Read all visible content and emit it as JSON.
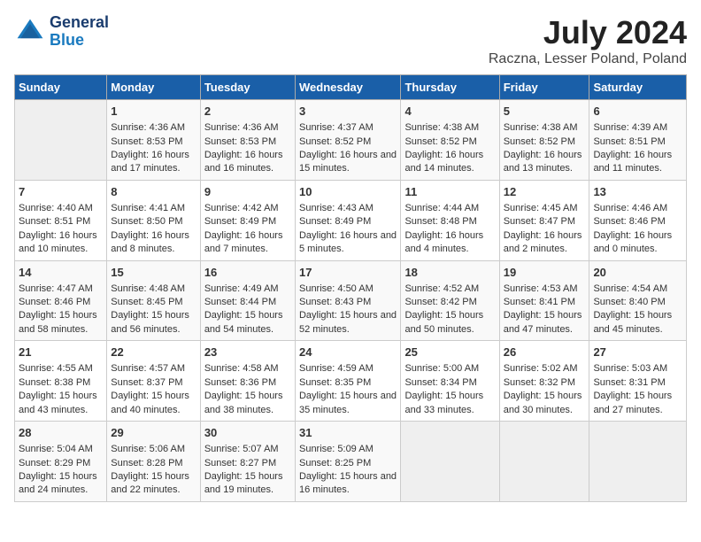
{
  "header": {
    "logo_line1": "General",
    "logo_line2": "Blue",
    "title": "July 2024",
    "subtitle": "Raczna, Lesser Poland, Poland"
  },
  "calendar": {
    "days_of_week": [
      "Sunday",
      "Monday",
      "Tuesday",
      "Wednesday",
      "Thursday",
      "Friday",
      "Saturday"
    ],
    "weeks": [
      [
        {
          "day": "",
          "sunrise": "",
          "sunset": "",
          "daylight": "",
          "empty": true
        },
        {
          "day": "1",
          "sunrise": "Sunrise: 4:36 AM",
          "sunset": "Sunset: 8:53 PM",
          "daylight": "Daylight: 16 hours and 17 minutes."
        },
        {
          "day": "2",
          "sunrise": "Sunrise: 4:36 AM",
          "sunset": "Sunset: 8:53 PM",
          "daylight": "Daylight: 16 hours and 16 minutes."
        },
        {
          "day": "3",
          "sunrise": "Sunrise: 4:37 AM",
          "sunset": "Sunset: 8:52 PM",
          "daylight": "Daylight: 16 hours and 15 minutes."
        },
        {
          "day": "4",
          "sunrise": "Sunrise: 4:38 AM",
          "sunset": "Sunset: 8:52 PM",
          "daylight": "Daylight: 16 hours and 14 minutes."
        },
        {
          "day": "5",
          "sunrise": "Sunrise: 4:38 AM",
          "sunset": "Sunset: 8:52 PM",
          "daylight": "Daylight: 16 hours and 13 minutes."
        },
        {
          "day": "6",
          "sunrise": "Sunrise: 4:39 AM",
          "sunset": "Sunset: 8:51 PM",
          "daylight": "Daylight: 16 hours and 11 minutes."
        }
      ],
      [
        {
          "day": "7",
          "sunrise": "Sunrise: 4:40 AM",
          "sunset": "Sunset: 8:51 PM",
          "daylight": "Daylight: 16 hours and 10 minutes."
        },
        {
          "day": "8",
          "sunrise": "Sunrise: 4:41 AM",
          "sunset": "Sunset: 8:50 PM",
          "daylight": "Daylight: 16 hours and 8 minutes."
        },
        {
          "day": "9",
          "sunrise": "Sunrise: 4:42 AM",
          "sunset": "Sunset: 8:49 PM",
          "daylight": "Daylight: 16 hours and 7 minutes."
        },
        {
          "day": "10",
          "sunrise": "Sunrise: 4:43 AM",
          "sunset": "Sunset: 8:49 PM",
          "daylight": "Daylight: 16 hours and 5 minutes."
        },
        {
          "day": "11",
          "sunrise": "Sunrise: 4:44 AM",
          "sunset": "Sunset: 8:48 PM",
          "daylight": "Daylight: 16 hours and 4 minutes."
        },
        {
          "day": "12",
          "sunrise": "Sunrise: 4:45 AM",
          "sunset": "Sunset: 8:47 PM",
          "daylight": "Daylight: 16 hours and 2 minutes."
        },
        {
          "day": "13",
          "sunrise": "Sunrise: 4:46 AM",
          "sunset": "Sunset: 8:46 PM",
          "daylight": "Daylight: 16 hours and 0 minutes."
        }
      ],
      [
        {
          "day": "14",
          "sunrise": "Sunrise: 4:47 AM",
          "sunset": "Sunset: 8:46 PM",
          "daylight": "Daylight: 15 hours and 58 minutes."
        },
        {
          "day": "15",
          "sunrise": "Sunrise: 4:48 AM",
          "sunset": "Sunset: 8:45 PM",
          "daylight": "Daylight: 15 hours and 56 minutes."
        },
        {
          "day": "16",
          "sunrise": "Sunrise: 4:49 AM",
          "sunset": "Sunset: 8:44 PM",
          "daylight": "Daylight: 15 hours and 54 minutes."
        },
        {
          "day": "17",
          "sunrise": "Sunrise: 4:50 AM",
          "sunset": "Sunset: 8:43 PM",
          "daylight": "Daylight: 15 hours and 52 minutes."
        },
        {
          "day": "18",
          "sunrise": "Sunrise: 4:52 AM",
          "sunset": "Sunset: 8:42 PM",
          "daylight": "Daylight: 15 hours and 50 minutes."
        },
        {
          "day": "19",
          "sunrise": "Sunrise: 4:53 AM",
          "sunset": "Sunset: 8:41 PM",
          "daylight": "Daylight: 15 hours and 47 minutes."
        },
        {
          "day": "20",
          "sunrise": "Sunrise: 4:54 AM",
          "sunset": "Sunset: 8:40 PM",
          "daylight": "Daylight: 15 hours and 45 minutes."
        }
      ],
      [
        {
          "day": "21",
          "sunrise": "Sunrise: 4:55 AM",
          "sunset": "Sunset: 8:38 PM",
          "daylight": "Daylight: 15 hours and 43 minutes."
        },
        {
          "day": "22",
          "sunrise": "Sunrise: 4:57 AM",
          "sunset": "Sunset: 8:37 PM",
          "daylight": "Daylight: 15 hours and 40 minutes."
        },
        {
          "day": "23",
          "sunrise": "Sunrise: 4:58 AM",
          "sunset": "Sunset: 8:36 PM",
          "daylight": "Daylight: 15 hours and 38 minutes."
        },
        {
          "day": "24",
          "sunrise": "Sunrise: 4:59 AM",
          "sunset": "Sunset: 8:35 PM",
          "daylight": "Daylight: 15 hours and 35 minutes."
        },
        {
          "day": "25",
          "sunrise": "Sunrise: 5:00 AM",
          "sunset": "Sunset: 8:34 PM",
          "daylight": "Daylight: 15 hours and 33 minutes."
        },
        {
          "day": "26",
          "sunrise": "Sunrise: 5:02 AM",
          "sunset": "Sunset: 8:32 PM",
          "daylight": "Daylight: 15 hours and 30 minutes."
        },
        {
          "day": "27",
          "sunrise": "Sunrise: 5:03 AM",
          "sunset": "Sunset: 8:31 PM",
          "daylight": "Daylight: 15 hours and 27 minutes."
        }
      ],
      [
        {
          "day": "28",
          "sunrise": "Sunrise: 5:04 AM",
          "sunset": "Sunset: 8:29 PM",
          "daylight": "Daylight: 15 hours and 24 minutes."
        },
        {
          "day": "29",
          "sunrise": "Sunrise: 5:06 AM",
          "sunset": "Sunset: 8:28 PM",
          "daylight": "Daylight: 15 hours and 22 minutes."
        },
        {
          "day": "30",
          "sunrise": "Sunrise: 5:07 AM",
          "sunset": "Sunset: 8:27 PM",
          "daylight": "Daylight: 15 hours and 19 minutes."
        },
        {
          "day": "31",
          "sunrise": "Sunrise: 5:09 AM",
          "sunset": "Sunset: 8:25 PM",
          "daylight": "Daylight: 15 hours and 16 minutes."
        },
        {
          "day": "",
          "sunrise": "",
          "sunset": "",
          "daylight": "",
          "empty": true
        },
        {
          "day": "",
          "sunrise": "",
          "sunset": "",
          "daylight": "",
          "empty": true
        },
        {
          "day": "",
          "sunrise": "",
          "sunset": "",
          "daylight": "",
          "empty": true
        }
      ]
    ]
  }
}
